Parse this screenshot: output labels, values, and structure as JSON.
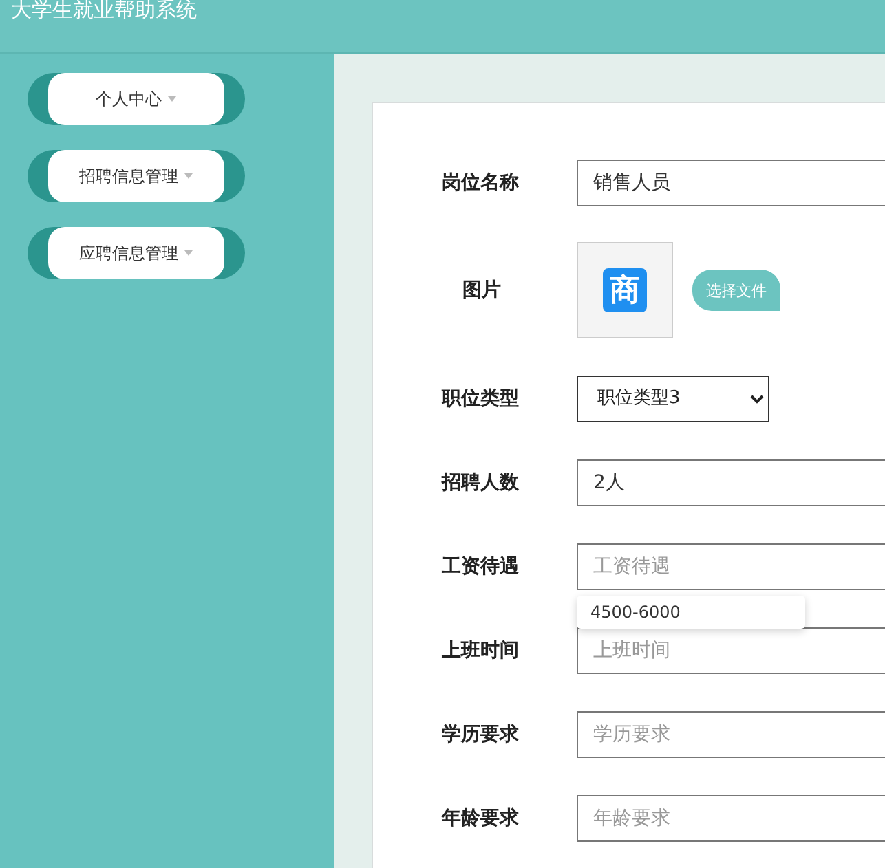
{
  "header": {
    "title": "大学生就业帮助系统"
  },
  "sidebar": {
    "items": [
      {
        "label": "个人中心"
      },
      {
        "label": "招聘信息管理"
      },
      {
        "label": "应聘信息管理"
      }
    ]
  },
  "form": {
    "rows": [
      {
        "kind": "text",
        "label": "岗位名称",
        "value": "销售人员"
      },
      {
        "kind": "image",
        "label": "图片",
        "icon_text": "商",
        "button": "选择文件"
      },
      {
        "kind": "select",
        "label": "职位类型",
        "value": "职位类型3"
      },
      {
        "kind": "text",
        "label": "招聘人数",
        "value": "2人"
      },
      {
        "kind": "text",
        "label": "工资待遇",
        "placeholder": "工资待遇",
        "suggestions": [
          "4500-6000"
        ]
      },
      {
        "kind": "text",
        "label": "上班时间",
        "placeholder": "上班时间"
      },
      {
        "kind": "text",
        "label": "学历要求",
        "placeholder": "学历要求"
      },
      {
        "kind": "text",
        "label": "年龄要求",
        "placeholder": "年龄要求"
      }
    ]
  }
}
